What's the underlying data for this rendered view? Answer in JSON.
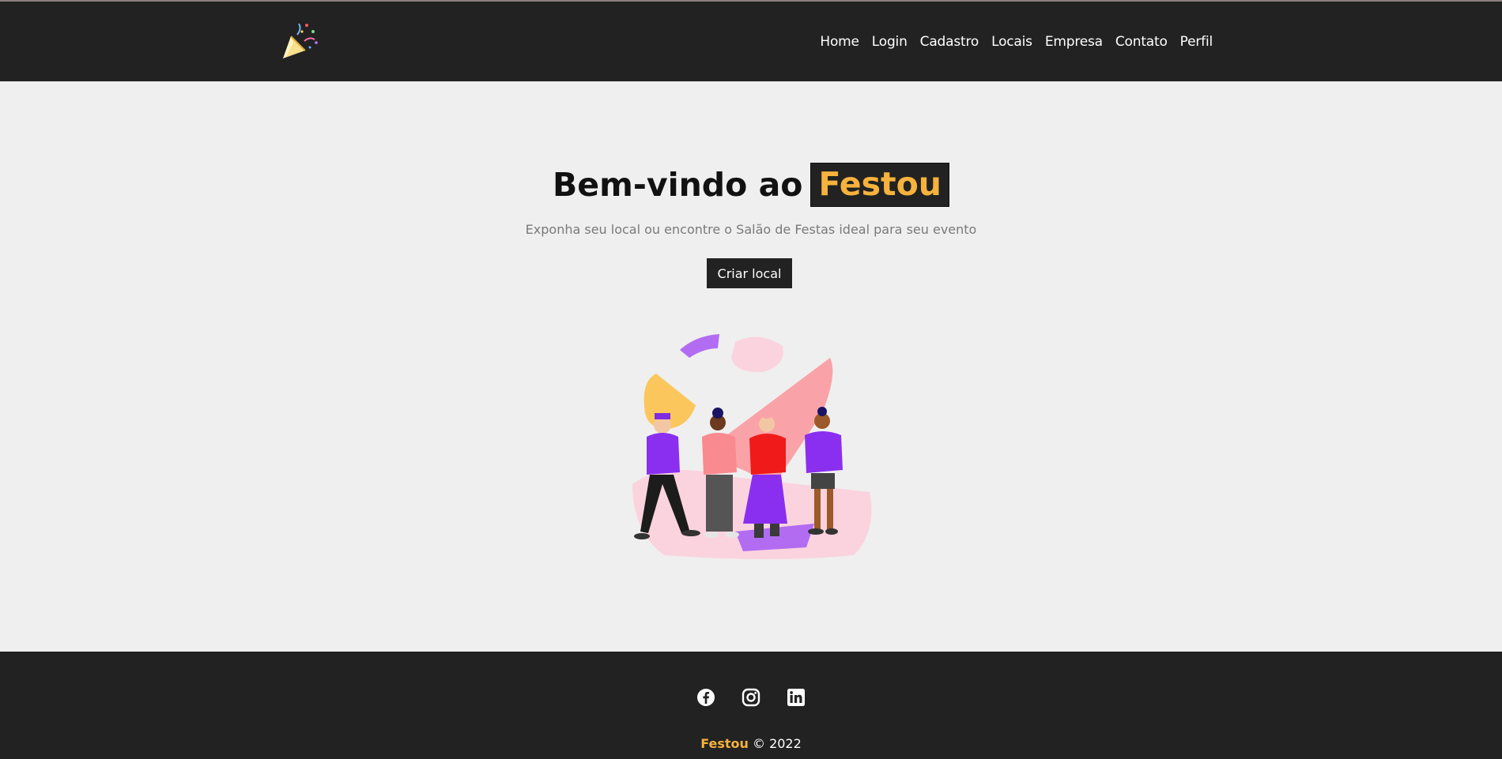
{
  "header": {
    "logo_icon": "party-popper-icon",
    "nav": [
      {
        "label": "Home"
      },
      {
        "label": "Login"
      },
      {
        "label": "Cadastro"
      },
      {
        "label": "Locais"
      },
      {
        "label": "Empresa"
      },
      {
        "label": "Contato"
      },
      {
        "label": "Perfil"
      }
    ]
  },
  "hero": {
    "title_prefix": "Bem-vindo ao",
    "title_brand": "Festou",
    "subtitle": "Exponha seu local ou encontre o Salão de Festas ideal para seu evento",
    "cta_label": "Criar local",
    "illustration": "group-of-friends-illustration"
  },
  "footer": {
    "socials": [
      "facebook-icon",
      "instagram-icon",
      "linkedin-icon"
    ],
    "brand": "Festou",
    "copyright": "© 2022"
  },
  "colors": {
    "dark": "#222222",
    "accent": "#f6b23c",
    "background": "#efefef"
  }
}
